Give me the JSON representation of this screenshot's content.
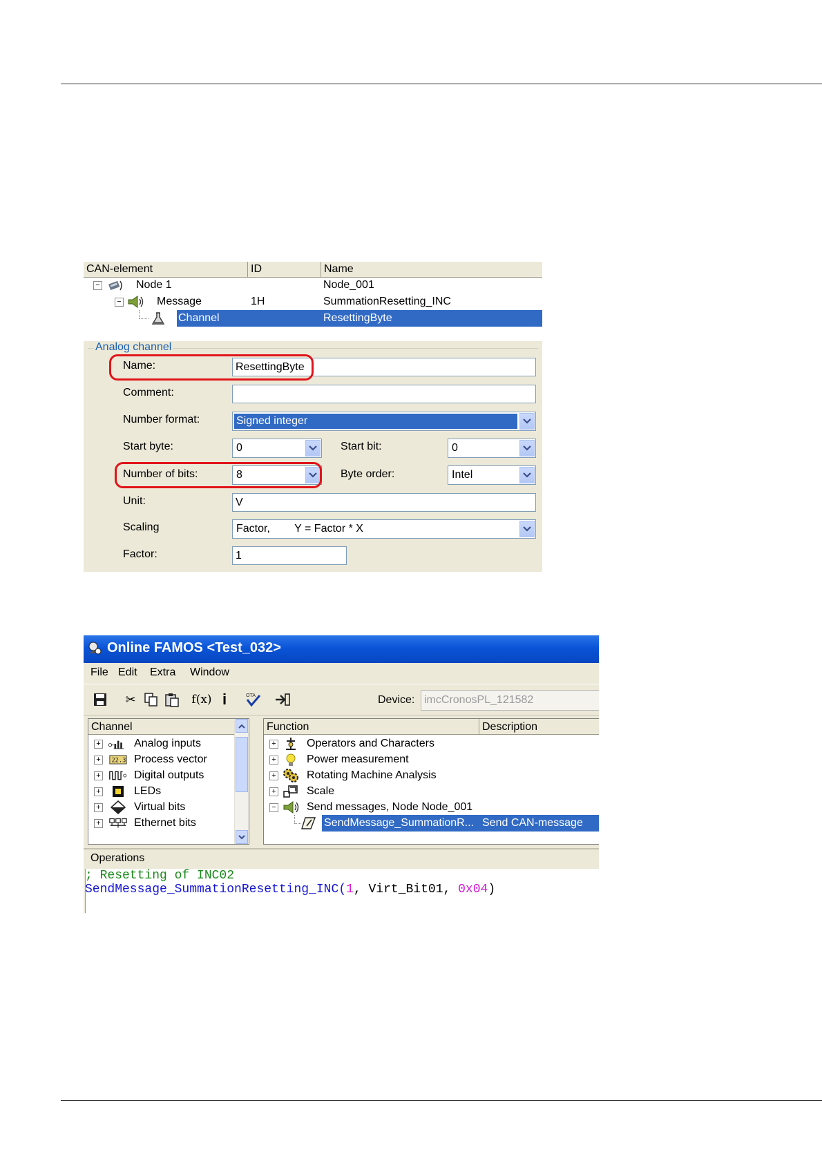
{
  "can_config": {
    "columns": [
      "CAN-element",
      "ID",
      "Name"
    ],
    "tree": [
      {
        "element": "Node 1",
        "id": "",
        "name": "Node_001",
        "icon": "node-icon",
        "expanded": true
      },
      {
        "element": "Message",
        "id": "1H",
        "name": "SummationResetting_INC",
        "icon": "message-icon",
        "expanded": true
      },
      {
        "element": "Channel",
        "id": "",
        "name": "ResettingByte",
        "icon": "flask-icon",
        "selected": true
      }
    ],
    "group_title": "Analog channel",
    "fields": {
      "name_label": "Name:",
      "name_value": "ResettingByte",
      "comment_label": "Comment:",
      "comment_value": "",
      "number_format_label": "Number format:",
      "number_format_value": "Signed integer",
      "start_byte_label": "Start byte:",
      "start_byte_value": "0",
      "start_bit_label": "Start bit:",
      "start_bit_value": "0",
      "bits_label": "Number of bits:",
      "bits_value": "8",
      "byte_order_label": "Byte order:",
      "byte_order_value": "Intel",
      "unit_label": "Unit:",
      "unit_value": "V",
      "scaling_label": "Scaling",
      "scaling_value": "Factor,        Y = Factor * X",
      "factor_label": "Factor:",
      "factor_value": "1"
    },
    "highlight_color": "#e0151a",
    "selection_color": "#316ac5"
  },
  "famos": {
    "title": "Online FAMOS <Test_032>",
    "menu": [
      "File",
      "Edit",
      "Extra",
      "Window"
    ],
    "device_label": "Device:",
    "device_value": "imcCronosPL_121582",
    "channel_header": "Channel",
    "channels": [
      {
        "label": "Analog inputs",
        "icon": "analog-inputs-icon"
      },
      {
        "label": "Process vector",
        "icon": "process-vector-icon"
      },
      {
        "label": "Digital outputs",
        "icon": "digital-outputs-icon"
      },
      {
        "label": "LEDs",
        "icon": "led-icon"
      },
      {
        "label": "Virtual bits",
        "icon": "virtual-bits-icon"
      },
      {
        "label": "Ethernet bits",
        "icon": "ethernet-bits-icon"
      }
    ],
    "function_header": "Function",
    "description_header": "Description",
    "functions": [
      {
        "label": "Operators and Characters",
        "icon": "operators-icon",
        "desc": ""
      },
      {
        "label": "Power measurement",
        "icon": "bulb-icon",
        "desc": ""
      },
      {
        "label": "Rotating Machine Analysis",
        "icon": "gears-icon",
        "desc": ""
      },
      {
        "label": "Scale",
        "icon": "scale-icon",
        "desc": ""
      },
      {
        "label": "Send messages, Node Node_001",
        "icon": "message-icon",
        "desc": ""
      },
      {
        "label": "SendMessage_SummationR...",
        "icon": "edit-icon",
        "desc": "Send CAN-message",
        "selected": true
      }
    ],
    "operations_label": "Operations",
    "code": {
      "comment": "; Resetting of INC02",
      "func": "SendMessage_SummationResetting_INC(",
      "arg1": "1",
      "sep1": ", Virt_Bit01, ",
      "arg3": "0x04",
      "close": ")"
    }
  }
}
